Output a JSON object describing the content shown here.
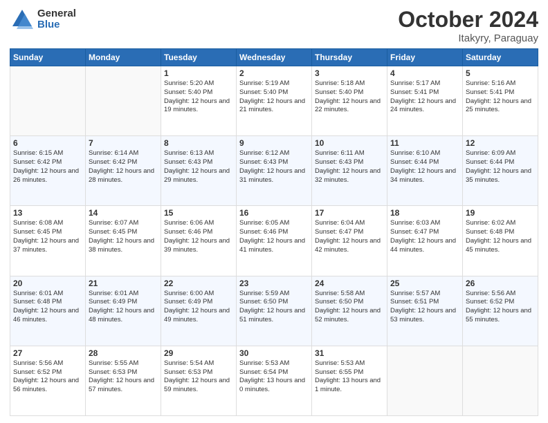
{
  "header": {
    "logo_general": "General",
    "logo_blue": "Blue",
    "month": "October 2024",
    "location": "Itakyry, Paraguay"
  },
  "days_of_week": [
    "Sunday",
    "Monday",
    "Tuesday",
    "Wednesday",
    "Thursday",
    "Friday",
    "Saturday"
  ],
  "weeks": [
    [
      {
        "day": "",
        "info": ""
      },
      {
        "day": "",
        "info": ""
      },
      {
        "day": "1",
        "info": "Sunrise: 5:20 AM\nSunset: 5:40 PM\nDaylight: 12 hours and 19 minutes."
      },
      {
        "day": "2",
        "info": "Sunrise: 5:19 AM\nSunset: 5:40 PM\nDaylight: 12 hours and 21 minutes."
      },
      {
        "day": "3",
        "info": "Sunrise: 5:18 AM\nSunset: 5:40 PM\nDaylight: 12 hours and 22 minutes."
      },
      {
        "day": "4",
        "info": "Sunrise: 5:17 AM\nSunset: 5:41 PM\nDaylight: 12 hours and 24 minutes."
      },
      {
        "day": "5",
        "info": "Sunrise: 5:16 AM\nSunset: 5:41 PM\nDaylight: 12 hours and 25 minutes."
      }
    ],
    [
      {
        "day": "6",
        "info": "Sunrise: 6:15 AM\nSunset: 6:42 PM\nDaylight: 12 hours and 26 minutes."
      },
      {
        "day": "7",
        "info": "Sunrise: 6:14 AM\nSunset: 6:42 PM\nDaylight: 12 hours and 28 minutes."
      },
      {
        "day": "8",
        "info": "Sunrise: 6:13 AM\nSunset: 6:43 PM\nDaylight: 12 hours and 29 minutes."
      },
      {
        "day": "9",
        "info": "Sunrise: 6:12 AM\nSunset: 6:43 PM\nDaylight: 12 hours and 31 minutes."
      },
      {
        "day": "10",
        "info": "Sunrise: 6:11 AM\nSunset: 6:43 PM\nDaylight: 12 hours and 32 minutes."
      },
      {
        "day": "11",
        "info": "Sunrise: 6:10 AM\nSunset: 6:44 PM\nDaylight: 12 hours and 34 minutes."
      },
      {
        "day": "12",
        "info": "Sunrise: 6:09 AM\nSunset: 6:44 PM\nDaylight: 12 hours and 35 minutes."
      }
    ],
    [
      {
        "day": "13",
        "info": "Sunrise: 6:08 AM\nSunset: 6:45 PM\nDaylight: 12 hours and 37 minutes."
      },
      {
        "day": "14",
        "info": "Sunrise: 6:07 AM\nSunset: 6:45 PM\nDaylight: 12 hours and 38 minutes."
      },
      {
        "day": "15",
        "info": "Sunrise: 6:06 AM\nSunset: 6:46 PM\nDaylight: 12 hours and 39 minutes."
      },
      {
        "day": "16",
        "info": "Sunrise: 6:05 AM\nSunset: 6:46 PM\nDaylight: 12 hours and 41 minutes."
      },
      {
        "day": "17",
        "info": "Sunrise: 6:04 AM\nSunset: 6:47 PM\nDaylight: 12 hours and 42 minutes."
      },
      {
        "day": "18",
        "info": "Sunrise: 6:03 AM\nSunset: 6:47 PM\nDaylight: 12 hours and 44 minutes."
      },
      {
        "day": "19",
        "info": "Sunrise: 6:02 AM\nSunset: 6:48 PM\nDaylight: 12 hours and 45 minutes."
      }
    ],
    [
      {
        "day": "20",
        "info": "Sunrise: 6:01 AM\nSunset: 6:48 PM\nDaylight: 12 hours and 46 minutes."
      },
      {
        "day": "21",
        "info": "Sunrise: 6:01 AM\nSunset: 6:49 PM\nDaylight: 12 hours and 48 minutes."
      },
      {
        "day": "22",
        "info": "Sunrise: 6:00 AM\nSunset: 6:49 PM\nDaylight: 12 hours and 49 minutes."
      },
      {
        "day": "23",
        "info": "Sunrise: 5:59 AM\nSunset: 6:50 PM\nDaylight: 12 hours and 51 minutes."
      },
      {
        "day": "24",
        "info": "Sunrise: 5:58 AM\nSunset: 6:50 PM\nDaylight: 12 hours and 52 minutes."
      },
      {
        "day": "25",
        "info": "Sunrise: 5:57 AM\nSunset: 6:51 PM\nDaylight: 12 hours and 53 minutes."
      },
      {
        "day": "26",
        "info": "Sunrise: 5:56 AM\nSunset: 6:52 PM\nDaylight: 12 hours and 55 minutes."
      }
    ],
    [
      {
        "day": "27",
        "info": "Sunrise: 5:56 AM\nSunset: 6:52 PM\nDaylight: 12 hours and 56 minutes."
      },
      {
        "day": "28",
        "info": "Sunrise: 5:55 AM\nSunset: 6:53 PM\nDaylight: 12 hours and 57 minutes."
      },
      {
        "day": "29",
        "info": "Sunrise: 5:54 AM\nSunset: 6:53 PM\nDaylight: 12 hours and 59 minutes."
      },
      {
        "day": "30",
        "info": "Sunrise: 5:53 AM\nSunset: 6:54 PM\nDaylight: 13 hours and 0 minutes."
      },
      {
        "day": "31",
        "info": "Sunrise: 5:53 AM\nSunset: 6:55 PM\nDaylight: 13 hours and 1 minute."
      },
      {
        "day": "",
        "info": ""
      },
      {
        "day": "",
        "info": ""
      }
    ]
  ]
}
